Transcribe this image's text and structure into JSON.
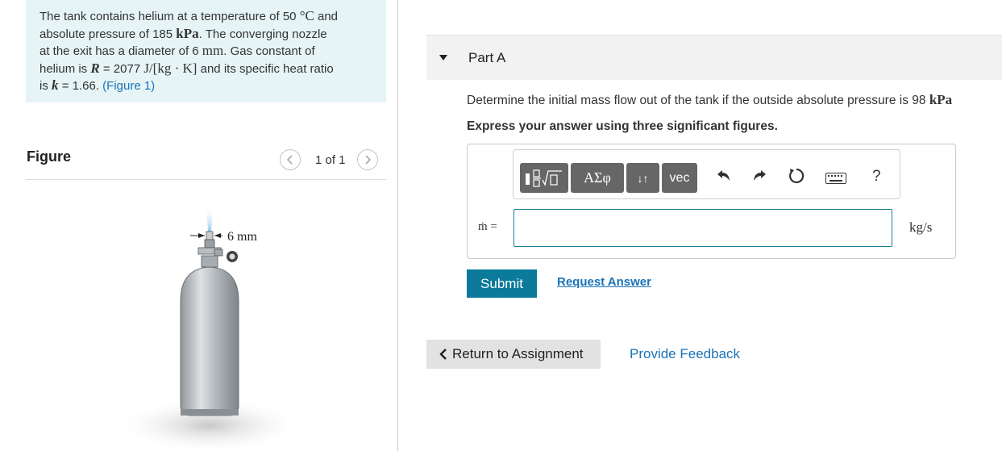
{
  "problem": {
    "line1_a": "The tank contains helium at a temperature of 50",
    "line1_unit": "°C",
    "line1_b": "and",
    "line2_a": "absolute pressure of 185",
    "line2_unit": "kPa",
    "line2_b": ". The converging nozzle",
    "line3_a": "at the exit has a diameter of 6",
    "line3_unit": "mm",
    "line3_b": ". Gas constant of",
    "line4_a": "helium is",
    "line4_sym": "R",
    "line4_b": "= 2077",
    "line4_unit": "J/[kg · K]",
    "line4_c": "and its specific heat ratio",
    "line5_a": "is",
    "line5_sym": "k",
    "line5_b": "= 1.66.",
    "figure_link": "(Figure 1)"
  },
  "figure": {
    "title": "Figure",
    "prev_icon": "chevron-left-icon",
    "next_icon": "chevron-right-icon",
    "counter": "1 of 1",
    "dimension_label": "6 mm"
  },
  "part": {
    "title": "Part A",
    "question_text": "Determine the initial mass flow out of the tank if the outside absolute pressure is 98",
    "question_unit": "kPa",
    "instruction": "Express your answer using three significant figures."
  },
  "toolbar": {
    "greek_label": "ΑΣφ",
    "arrows_label": "↓↑",
    "vec_label": "vec",
    "help_label": "?"
  },
  "answer": {
    "variable_label": "ṁ =",
    "value": "",
    "unit": "kg/s"
  },
  "actions": {
    "submit_label": "Submit",
    "request_answer_label": "Request Answer",
    "return_label": "Return to Assignment",
    "feedback_label": "Provide Feedback"
  },
  "colors": {
    "problem_bg": "#e6f4f6",
    "link": "#1a73b8",
    "submit_bg": "#0b7a9b",
    "toolbar_button": "#666666"
  }
}
